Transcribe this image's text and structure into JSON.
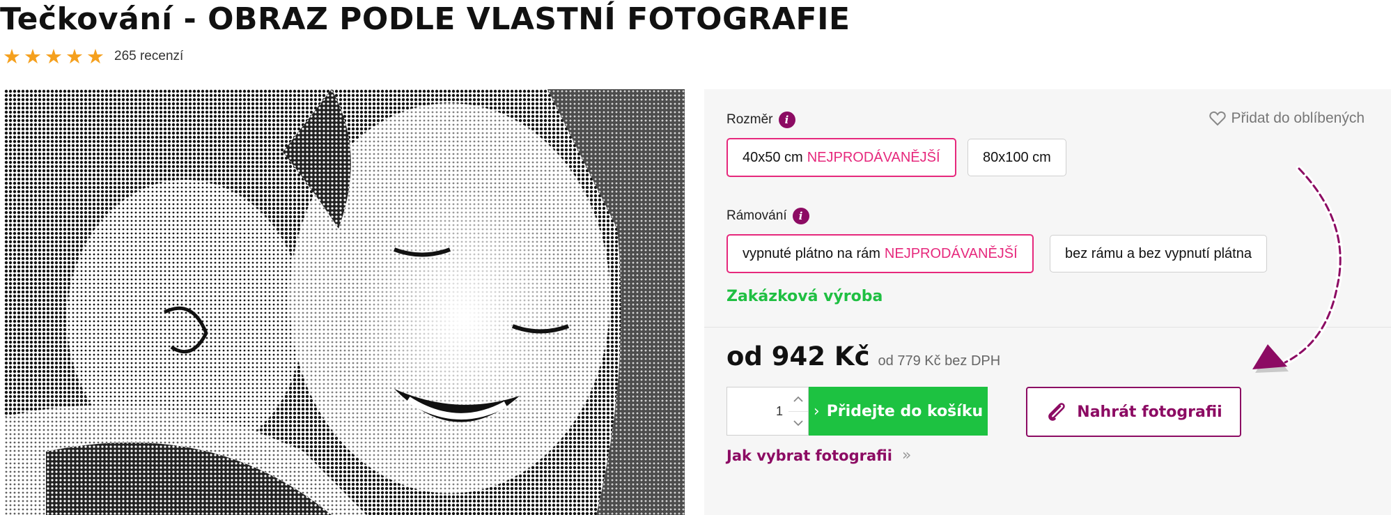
{
  "product": {
    "title": "Tečkování - OBRAZ PODLE VLASTNÍ FOTOGRAFIE",
    "rating_stars": 5,
    "reviews": "265 recenzí"
  },
  "options": {
    "size_label": "Rozměr",
    "favorite": "Přidat do oblíbených",
    "sizes": [
      {
        "label": "40x50 cm",
        "badge": "NEJPRODÁVANĚJŠÍ",
        "selected": true
      },
      {
        "label": "80x100 cm",
        "badge": "",
        "selected": false
      }
    ],
    "framing_label": "Rámování",
    "framings": [
      {
        "label": "vypnuté plátno na rám",
        "badge": "NEJPRODÁVANĚJŠÍ",
        "selected": true
      },
      {
        "label": "bez rámu a bez vypnutí plátna",
        "badge": "",
        "selected": false
      }
    ],
    "custom_note": "Zakázková výroba"
  },
  "purchase": {
    "price": "od 942 Kč",
    "price_ex_vat": "od 779 Kč bez DPH",
    "quantity": "1",
    "add_to_cart": "Přidejte do košíku",
    "upload": "Nahrát fotografii",
    "how_to": "Jak vybrat fotografii"
  },
  "colors": {
    "accent": "#8c0b63",
    "badge": "#e6287c",
    "green": "#1dc241",
    "star": "#f5a01d"
  },
  "icons": [
    "star-icon",
    "info-icon",
    "heart-icon",
    "chevron-up-icon",
    "chevron-down-icon",
    "chevron-right-icon",
    "paperclip-icon",
    "double-chevron-right-icon",
    "curved-arrow-icon"
  ]
}
